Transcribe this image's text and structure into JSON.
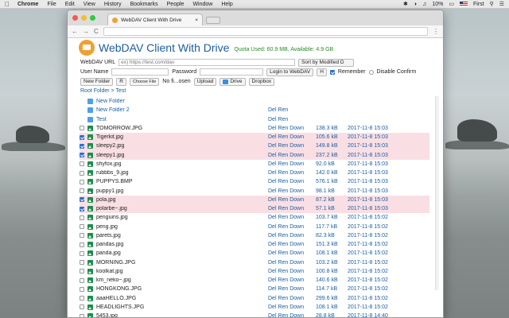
{
  "menubar": {
    "app": "Chrome",
    "items": [
      "File",
      "Edit",
      "View",
      "History",
      "Bookmarks",
      "People",
      "Window",
      "Help"
    ],
    "battery": "10%",
    "user": "First"
  },
  "browser": {
    "tab_title": "WebDAV Client With Drive",
    "tab_close": "×",
    "url": "",
    "back": "←",
    "forward": "→",
    "reload": "C"
  },
  "app": {
    "title": "WebDAV Client With Drive",
    "quota": "Quota Used: 60.9 MB, Available: 4.9 GB",
    "url_label": "WebDAV URL",
    "url_placeholder": "ex) https://test.com/dav",
    "sort_label": "Sort by Modified D",
    "user_label": "User Name",
    "password_label": "Password",
    "login_button": "Login to WebDAV",
    "h_button": "H",
    "remember_label": "Remember",
    "remember_checked": true,
    "disable_confirm_label": "Disable Confirm",
    "new_folder_button": "New Folder",
    "r_button": "R",
    "choose_file_button": "Choose File",
    "no_file_text": "No fi...osen",
    "upload_button": "Upload",
    "drive_button": "Drive",
    "dropbox_button": "Dropbox",
    "breadcrumb": "Root Folder > Test"
  },
  "files": [
    {
      "type": "folder",
      "name": "New Folder",
      "owner": "",
      "size": "",
      "date": "",
      "selected": false
    },
    {
      "type": "folder",
      "name": "New Folder 2",
      "owner": "Del Ren",
      "size": "",
      "date": "",
      "selected": false
    },
    {
      "type": "folder",
      "name": "Test",
      "owner": "Del Ren",
      "size": "",
      "date": "",
      "selected": false
    },
    {
      "type": "file",
      "name": "TOMORROW.JPG",
      "owner": "Del Ren Down",
      "size": "138.3 kB",
      "date": "2017-11-8 15:03",
      "selected": false
    },
    {
      "type": "file",
      "name": "Tigerkit.jpg",
      "owner": "Del Ren Down",
      "size": "105.6 kB",
      "date": "2017-11-8 15:03",
      "selected": true
    },
    {
      "type": "file",
      "name": "sleepy2.jpg",
      "owner": "Del Ren Down",
      "size": "149.8 kB",
      "date": "2017-11-8 15:03",
      "selected": true
    },
    {
      "type": "file",
      "name": "sleepy1.jpg",
      "owner": "Del Ren Down",
      "size": "237.2 kB",
      "date": "2017-11-8 15:03",
      "selected": true
    },
    {
      "type": "file",
      "name": "shyfox.jpg",
      "owner": "Del Ren Down",
      "size": "92.0 kB",
      "date": "2017-11-8 15:03",
      "selected": false
    },
    {
      "type": "file",
      "name": "rubbbs_9.jpg",
      "owner": "Del Ren Down",
      "size": "142.0 kB",
      "date": "2017-11-8 15:03",
      "selected": false
    },
    {
      "type": "file",
      "name": "PUPPYS.BMP",
      "owner": "Del Ren Down",
      "size": "576.1 kB",
      "date": "2017-11-8 15:03",
      "selected": false
    },
    {
      "type": "file",
      "name": "puppy1.jpg",
      "owner": "Del Ren Down",
      "size": "98.1 kB",
      "date": "2017-11-8 15:03",
      "selected": false
    },
    {
      "type": "file",
      "name": "pola.jpg",
      "owner": "Del Ren Down",
      "size": "87.2 kB",
      "date": "2017-11-8 15:03",
      "selected": true
    },
    {
      "type": "file",
      "name": "polarbe~.jpg",
      "owner": "Del Ren Down",
      "size": "57.1 kB",
      "date": "2017-11-8 15:03",
      "selected": true
    },
    {
      "type": "file",
      "name": "penguins.jpg",
      "owner": "Del Ren Down",
      "size": "103.7 kB",
      "date": "2017-11-8 15:02",
      "selected": false
    },
    {
      "type": "file",
      "name": "peng.jpg",
      "owner": "Del Ren Down",
      "size": "117.7 kB",
      "date": "2017-11-8 15:02",
      "selected": false
    },
    {
      "type": "file",
      "name": "parets.jpg",
      "owner": "Del Ren Down",
      "size": "82.3 kB",
      "date": "2017-11-8 15:02",
      "selected": false
    },
    {
      "type": "file",
      "name": "pandas.jpg",
      "owner": "Del Ren Down",
      "size": "151.3 kB",
      "date": "2017-11-8 15:02",
      "selected": false
    },
    {
      "type": "file",
      "name": "panda.jpg",
      "owner": "Del Ren Down",
      "size": "108.1 kB",
      "date": "2017-11-8 15:02",
      "selected": false
    },
    {
      "type": "file",
      "name": "MORNING.JPG",
      "owner": "Del Ren Down",
      "size": "103.2 kB",
      "date": "2017-11-8 15:02",
      "selected": false
    },
    {
      "type": "file",
      "name": "koolkat.jpg",
      "owner": "Del Ren Down",
      "size": "100.8 kB",
      "date": "2017-11-8 15:02",
      "selected": false
    },
    {
      "type": "file",
      "name": "km_neko~.jpg",
      "owner": "Del Ren Down",
      "size": "140.6 kB",
      "date": "2017-11-8 15:02",
      "selected": false
    },
    {
      "type": "file",
      "name": "HONGKONG.JPG",
      "owner": "Del Ren Down",
      "size": "114.7 kB",
      "date": "2017-11-8 15:02",
      "selected": false
    },
    {
      "type": "file",
      "name": "aaaHELLO.JPG",
      "owner": "Del Ren Down",
      "size": "299.6 kB",
      "date": "2017-11-8 15:02",
      "selected": false
    },
    {
      "type": "file",
      "name": "HEADLIGHTS.JPG",
      "owner": "Del Ren Down",
      "size": "108.1 kB",
      "date": "2017-11-8 15:02",
      "selected": false
    },
    {
      "type": "file",
      "name": "5453.jpg",
      "owner": "Del Ren Down",
      "size": "28.8 kB",
      "date": "2017-11-8 14:40",
      "selected": false
    }
  ]
}
